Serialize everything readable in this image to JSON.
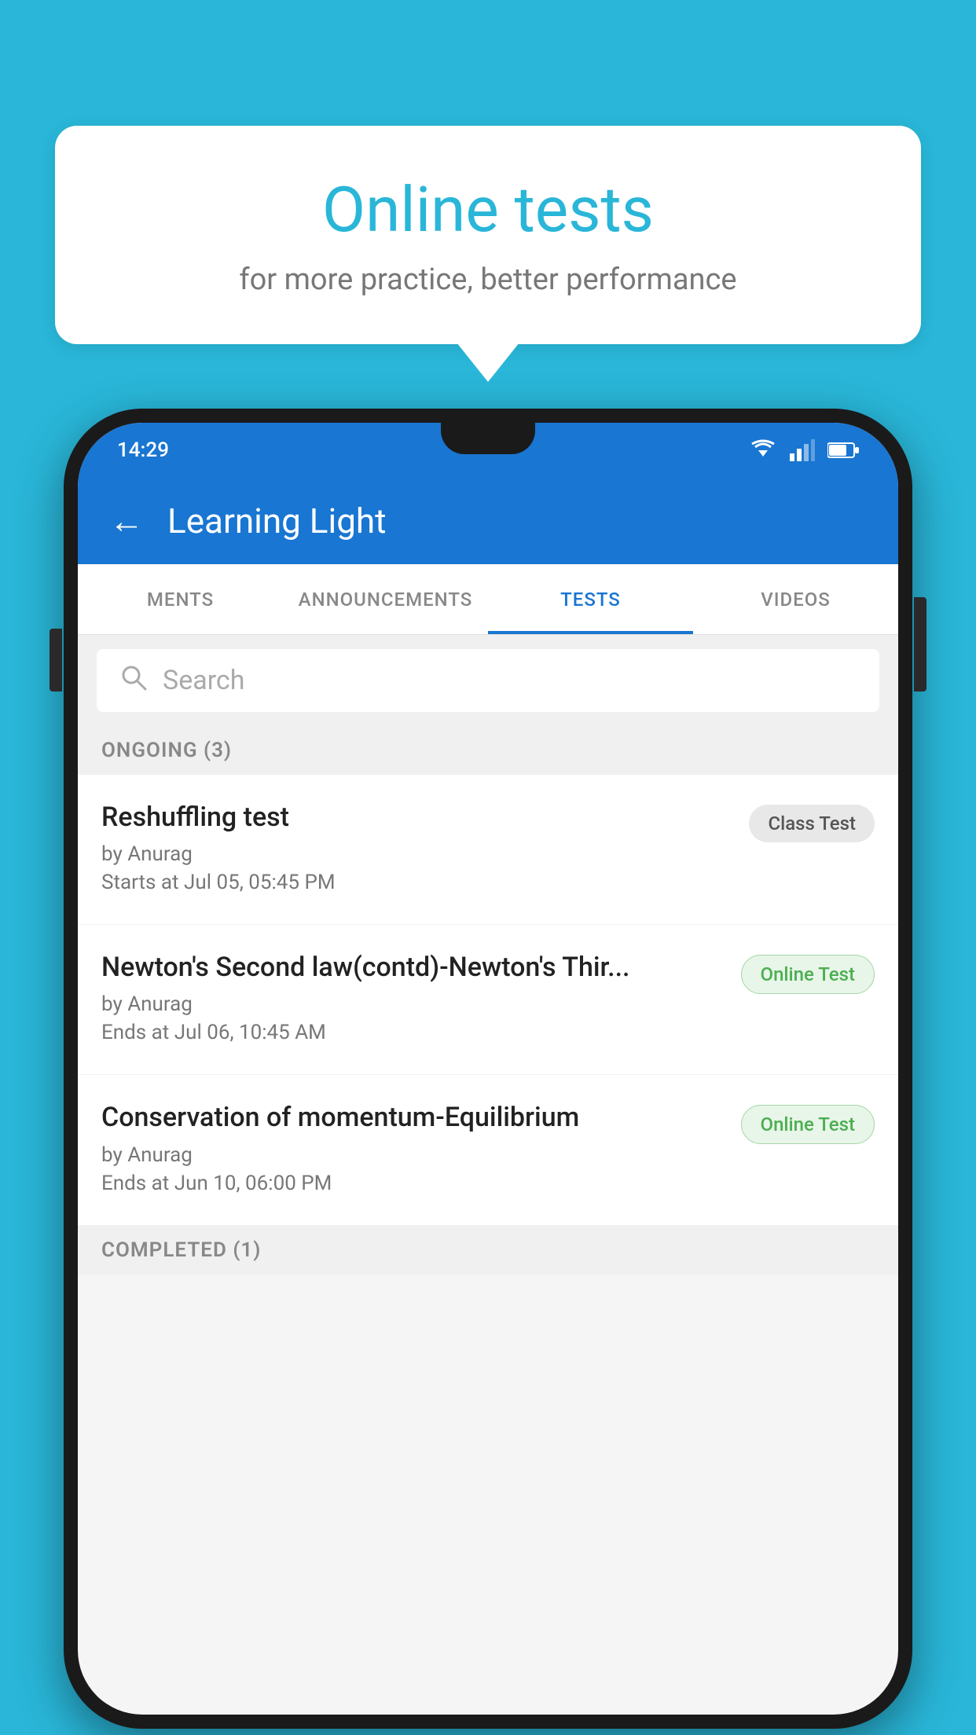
{
  "background_color": "#29b6d8",
  "bubble": {
    "title": "Online tests",
    "subtitle": "for more practice, better performance"
  },
  "phone": {
    "status_bar": {
      "time": "14:29"
    },
    "app_bar": {
      "title": "Learning Light",
      "back_label": "←"
    },
    "tabs": [
      {
        "id": "ments",
        "label": "MENTS",
        "active": false
      },
      {
        "id": "announcements",
        "label": "ANNOUNCEMENTS",
        "active": false
      },
      {
        "id": "tests",
        "label": "TESTS",
        "active": true
      },
      {
        "id": "videos",
        "label": "VIDEOS",
        "active": false
      }
    ],
    "search": {
      "placeholder": "Search"
    },
    "ongoing_section": {
      "label": "ONGOING (3)"
    },
    "tests": [
      {
        "name": "Reshuffling test",
        "author": "by Anurag",
        "time_label": "Starts at",
        "time": "Jul 05, 05:45 PM",
        "badge": "Class Test",
        "badge_type": "class"
      },
      {
        "name": "Newton's Second law(contd)-Newton's Thir...",
        "author": "by Anurag",
        "time_label": "Ends at",
        "time": "Jul 06, 10:45 AM",
        "badge": "Online Test",
        "badge_type": "online"
      },
      {
        "name": "Conservation of momentum-Equilibrium",
        "author": "by Anurag",
        "time_label": "Ends at",
        "time": "Jun 10, 06:00 PM",
        "badge": "Online Test",
        "badge_type": "online"
      }
    ],
    "completed_section": {
      "label": "COMPLETED (1)"
    }
  }
}
